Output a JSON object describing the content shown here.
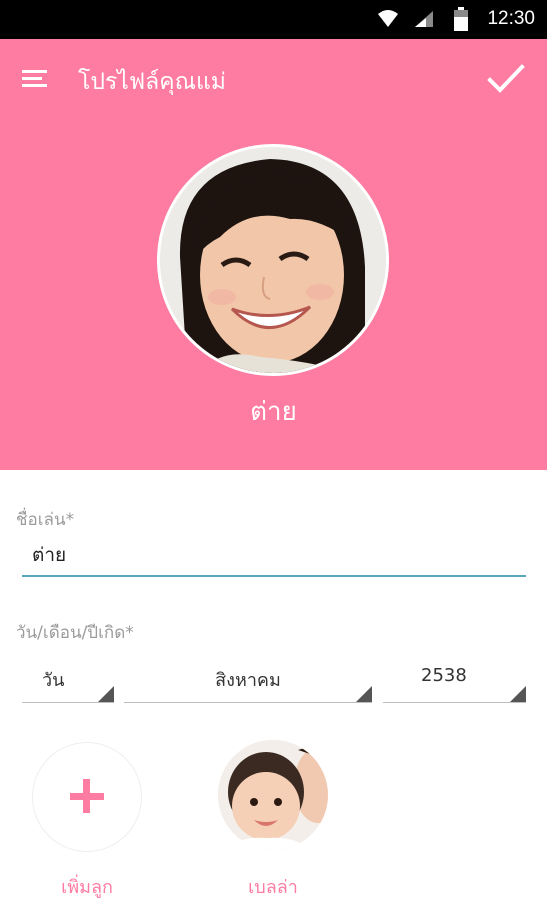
{
  "status_bar": {
    "time": "12:30",
    "icons": [
      "wifi-icon",
      "cell-signal-icon",
      "battery-icon"
    ]
  },
  "app_bar": {
    "title": "โปรไฟล์คุณแม่",
    "menu_icon": "hamburger-menu-icon",
    "confirm_icon": "checkmark-icon"
  },
  "profile": {
    "display_name": "ต่าย",
    "photo": "mother-portrait-photo"
  },
  "form": {
    "nickname_label": "ชื่อเล่น*",
    "nickname_value": "ต่าย",
    "birthdate_label": "วัน/เดือน/ปีเกิด*",
    "day_value": "วัน",
    "month_value": "สิงหาคม",
    "year_value": "2538"
  },
  "children": {
    "add_label": "เพิ่มลูก",
    "add_icon": "plus-icon",
    "items": [
      {
        "name": "เบลล่า",
        "photo": "baby-portrait-photo"
      }
    ]
  },
  "colors": {
    "primary": "#fe7ba1",
    "input_underline": "#5aa6bf",
    "status_bar": "#000000"
  }
}
